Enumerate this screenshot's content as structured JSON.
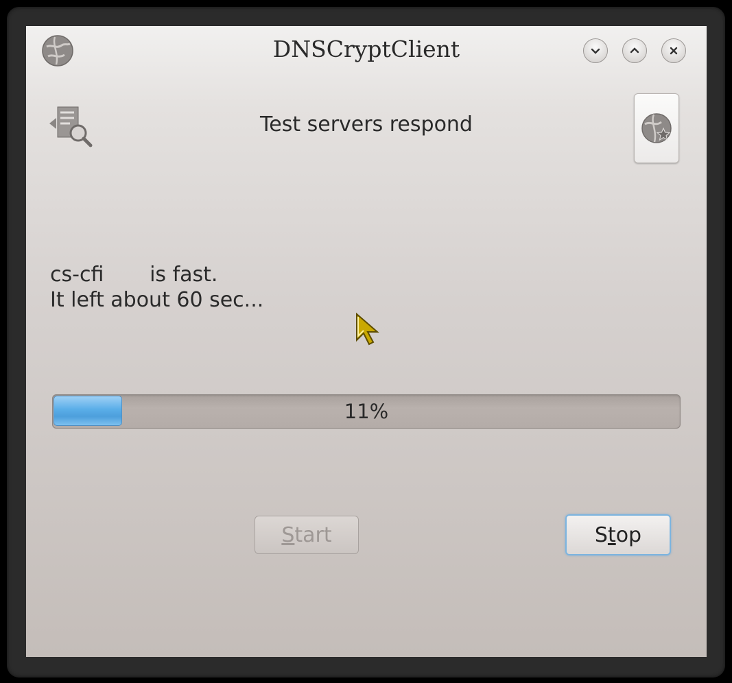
{
  "window": {
    "title": "DNSCrypt",
    "title_full": "DNSCryptClient"
  },
  "titlebar_buttons": {
    "minimize_icon": "chevron-down-icon",
    "maximize_icon": "chevron-up-icon",
    "close_icon": "close-icon"
  },
  "header": {
    "label": "Test servers respond",
    "left_icon": "document-find-icon",
    "right_button_icon": "network-favorite-icon"
  },
  "status": {
    "line1": "cs-cfi       is fast.",
    "line2": "It left about 60 sec..."
  },
  "progress": {
    "value": 0.11,
    "text": "11%"
  },
  "buttons": {
    "start_mnemonic": "S",
    "start_rest": "tart",
    "stop_prefix": "S",
    "stop_mnemonic": "t",
    "stop_rest": "op"
  },
  "colors": {
    "accent": "#5aaee8",
    "focus_ring": "#7cb4df"
  }
}
